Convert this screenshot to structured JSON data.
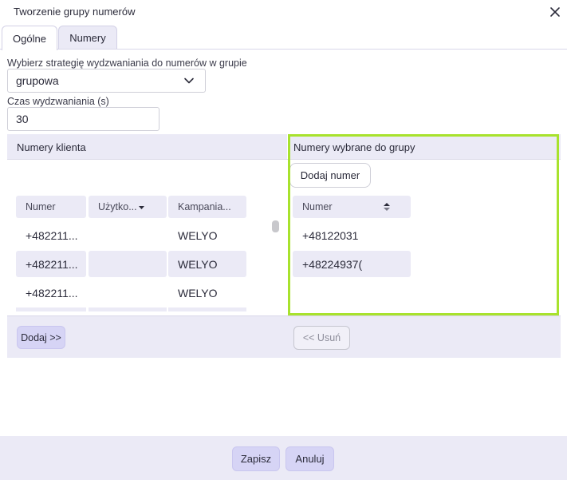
{
  "dialog": {
    "title": "Tworzenie grupy numerów",
    "close_icon": "close-icon"
  },
  "tabs": [
    {
      "label": "Ogólne",
      "active": true
    },
    {
      "label": "Numery",
      "active": false
    }
  ],
  "form": {
    "strategy_label": "Wybierz strategię wydzwaniania do numerów w grupie",
    "strategy_value": "grupowa",
    "dial_time_label": "Czas wydzwaniania (s)",
    "dial_time_value": "30"
  },
  "client_numbers": {
    "header": "Numery klienta",
    "columns": [
      "Numer",
      "Użytko...",
      "Kampania..."
    ],
    "rows": [
      [
        "+482211...",
        "",
        "WELYO"
      ],
      [
        "+482211...",
        "",
        "WELYO"
      ],
      [
        "+482211...",
        "",
        "WELYO"
      ]
    ],
    "add_button": "Dodaj >>"
  },
  "selected_numbers": {
    "header": "Numery wybrane do grupy",
    "add_number_button": "Dodaj numer",
    "columns": [
      "Numer"
    ],
    "rows": [
      "+48122031",
      "+48224937("
    ],
    "remove_button": "<< Usuń"
  },
  "footer": {
    "save": "Zapisz",
    "cancel": "Anuluj"
  },
  "colors": {
    "highlight": "#a8e22d",
    "accent_button": "#d6d4f5",
    "panel_bg": "#ebeaf6"
  }
}
